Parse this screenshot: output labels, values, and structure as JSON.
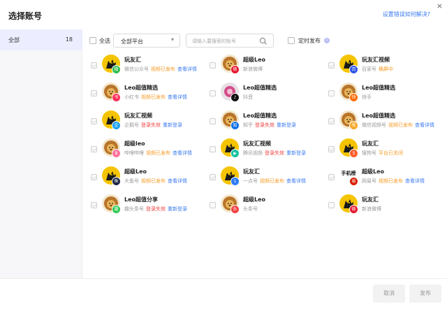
{
  "header": {
    "title": "选择账号",
    "help": "设置错误如何解决?",
    "close": "×"
  },
  "sidebar": {
    "items": [
      {
        "label": "全部",
        "count": "18"
      }
    ]
  },
  "toolbar": {
    "select_all": "全选",
    "platform": "全部平台",
    "search_placeholder": "请输入要搜索的账号",
    "scheduled": "定时发布",
    "info": "i"
  },
  "colors": {
    "accent": "#3b7bf0",
    "published": "#f59a23",
    "failed": "#ee3f3f",
    "selected_bg": "#eceeff"
  },
  "accounts": [
    {
      "name": "玩友汇",
      "platform": "微信公众号",
      "status": "视频已发布",
      "status_type": "pub",
      "action": "查看详情",
      "avatar": "dog",
      "badge": "wechat",
      "disabled": true
    },
    {
      "name": "超级Leo",
      "platform": "新浪微博",
      "status": "",
      "status_type": "",
      "action": "",
      "avatar": "lion",
      "badge": "weibo",
      "disabled": false
    },
    {
      "name": "玩友汇视频",
      "platform": "百家号",
      "status": "横屏中",
      "status_type": "pend",
      "action": "",
      "avatar": "dog",
      "badge": "baijia",
      "disabled": true
    },
    {
      "name": "Leo超值精选",
      "platform": "小红书",
      "status": "视频已发布",
      "status_type": "pub",
      "action": "查看详情",
      "avatar": "lion",
      "badge": "xhs",
      "disabled": true
    },
    {
      "name": "Leo超值精选",
      "platform": "抖音",
      "status": "",
      "status_type": "",
      "action": "",
      "avatar": "pink",
      "badge": "douyin",
      "disabled": false
    },
    {
      "name": "Leo超值精选",
      "platform": "快手",
      "status": "",
      "status_type": "",
      "action": "",
      "avatar": "lion",
      "badge": "kuaishou",
      "disabled": false
    },
    {
      "name": "玩友汇视频",
      "platform": "企鹅号",
      "status": "登录失效",
      "status_type": "fail",
      "action": "重新登录",
      "avatar": "dog",
      "badge": "penguin",
      "disabled": true
    },
    {
      "name": "Leo超值精选",
      "platform": "知乎",
      "status": "登录失效",
      "status_type": "fail",
      "action": "重新登录",
      "avatar": "lion",
      "badge": "zhihu",
      "disabled": false
    },
    {
      "name": "Leo超值精选",
      "platform": "微信视频号",
      "status": "视频已发布",
      "status_type": "pub",
      "action": "查看详情",
      "avatar": "lion",
      "badge": "channels",
      "disabled": true
    },
    {
      "name": "超级leo",
      "platform": "哔哩哔哩",
      "status": "视频已发布",
      "status_type": "pub",
      "action": "查看详情",
      "avatar": "lion",
      "badge": "bili",
      "disabled": true
    },
    {
      "name": "玩友汇视频",
      "platform": "腾讯视频",
      "status": "登录失效",
      "status_type": "fail",
      "action": "重新登录",
      "avatar": "dog",
      "badge": "tencent",
      "disabled": false
    },
    {
      "name": "玩友汇",
      "platform": "搜狗号",
      "status": "平台已关闭",
      "status_type": "closed",
      "action": "",
      "avatar": "dog",
      "badge": "sogou",
      "disabled": true
    },
    {
      "name": "超级Leo",
      "platform": "大鱼号",
      "status": "视频已发布",
      "status_type": "pub",
      "action": "查看详情",
      "avatar": "dog",
      "badge": "dayu",
      "disabled": true
    },
    {
      "name": "玩友汇",
      "platform": "一点号",
      "status": "视频已发布",
      "status_type": "pub",
      "action": "查看详情",
      "avatar": "dog",
      "badge": "yidian",
      "disabled": true
    },
    {
      "name": "超级Leo",
      "platform": "网易号",
      "status": "视频已发布",
      "status_type": "pub",
      "action": "查看详情",
      "avatar": "text",
      "avatar_text": "手机榜",
      "badge": "netease",
      "disabled": true
    },
    {
      "name": "Leo超值分享",
      "platform": "趣头条号",
      "status": "登录失效",
      "status_type": "fail",
      "action": "重新登录",
      "avatar": "lion",
      "badge": "qutoutiao",
      "disabled": true
    },
    {
      "name": "超级Leo",
      "platform": "头条号",
      "status": "",
      "status_type": "",
      "action": "",
      "avatar": "lion",
      "badge": "toutiao",
      "disabled": false
    },
    {
      "name": "玩友汇",
      "platform": "新浪微博",
      "status": "",
      "status_type": "",
      "action": "",
      "avatar": "dog",
      "badge": "weibo",
      "disabled": false
    }
  ],
  "footer": {
    "cancel": "取消",
    "publish": "发布"
  }
}
